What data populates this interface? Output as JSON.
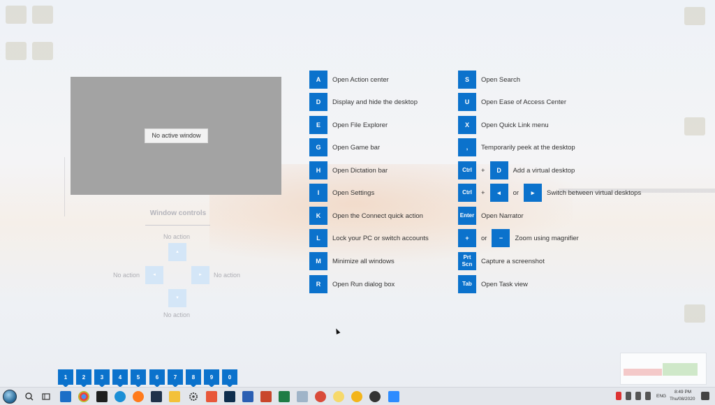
{
  "preview": {
    "no_active_window": "No active window"
  },
  "window_controls": {
    "title": "Window controls",
    "top": "No action",
    "left": "No action",
    "right": "No action",
    "bottom": "No action"
  },
  "shortcuts_left": [
    {
      "key": "A",
      "desc": "Open Action center"
    },
    {
      "key": "D",
      "desc": "Display and hide the desktop"
    },
    {
      "key": "E",
      "desc": "Open File Explorer"
    },
    {
      "key": "G",
      "desc": "Open Game bar"
    },
    {
      "key": "H",
      "desc": "Open Dictation bar"
    },
    {
      "key": "I",
      "desc": "Open Settings"
    },
    {
      "key": "K",
      "desc": "Open the Connect quick action"
    },
    {
      "key": "L",
      "desc": "Lock your PC or switch accounts"
    },
    {
      "key": "M",
      "desc": "Minimize all windows"
    },
    {
      "key": "R",
      "desc": "Open Run dialog box"
    }
  ],
  "shortcuts_right": {
    "s": {
      "key": "S",
      "desc": "Open Search"
    },
    "u": {
      "key": "U",
      "desc": "Open Ease of Access Center"
    },
    "x": {
      "key": "X",
      "desc": "Open Quick Link menu"
    },
    "comma": {
      "key": ",",
      "desc": "Temporarily peek at the desktop"
    },
    "vd_add": {
      "key1": "Ctrl",
      "plus": "+",
      "key2": "D",
      "desc": "Add a virtual desktop"
    },
    "vd_switch": {
      "key1": "Ctrl",
      "plus": "+",
      "key2": "◂",
      "or": "or",
      "key3": "▸",
      "desc": "Switch between virtual desktops"
    },
    "enter": {
      "key": "Enter",
      "desc": "Open Narrator"
    },
    "zoom": {
      "key1": "+",
      "or": "or",
      "key2": "−",
      "desc": "Zoom using magnifier"
    },
    "prtscn": {
      "key_line1": "Prt",
      "key_line2": "Scn",
      "desc": "Capture a screenshot"
    },
    "tab": {
      "key": "Tab",
      "desc": "Open Task view"
    }
  },
  "taskbar_numbers": [
    "1",
    "2",
    "3",
    "4",
    "5",
    "6",
    "7",
    "8",
    "9",
    "0"
  ],
  "tray": {
    "language": "ENG",
    "time": "8:49 PM",
    "date": "Thu/08/2020"
  },
  "colors": {
    "key_blue": "#0b72cc",
    "preview_gray": "#a3a3a3"
  }
}
